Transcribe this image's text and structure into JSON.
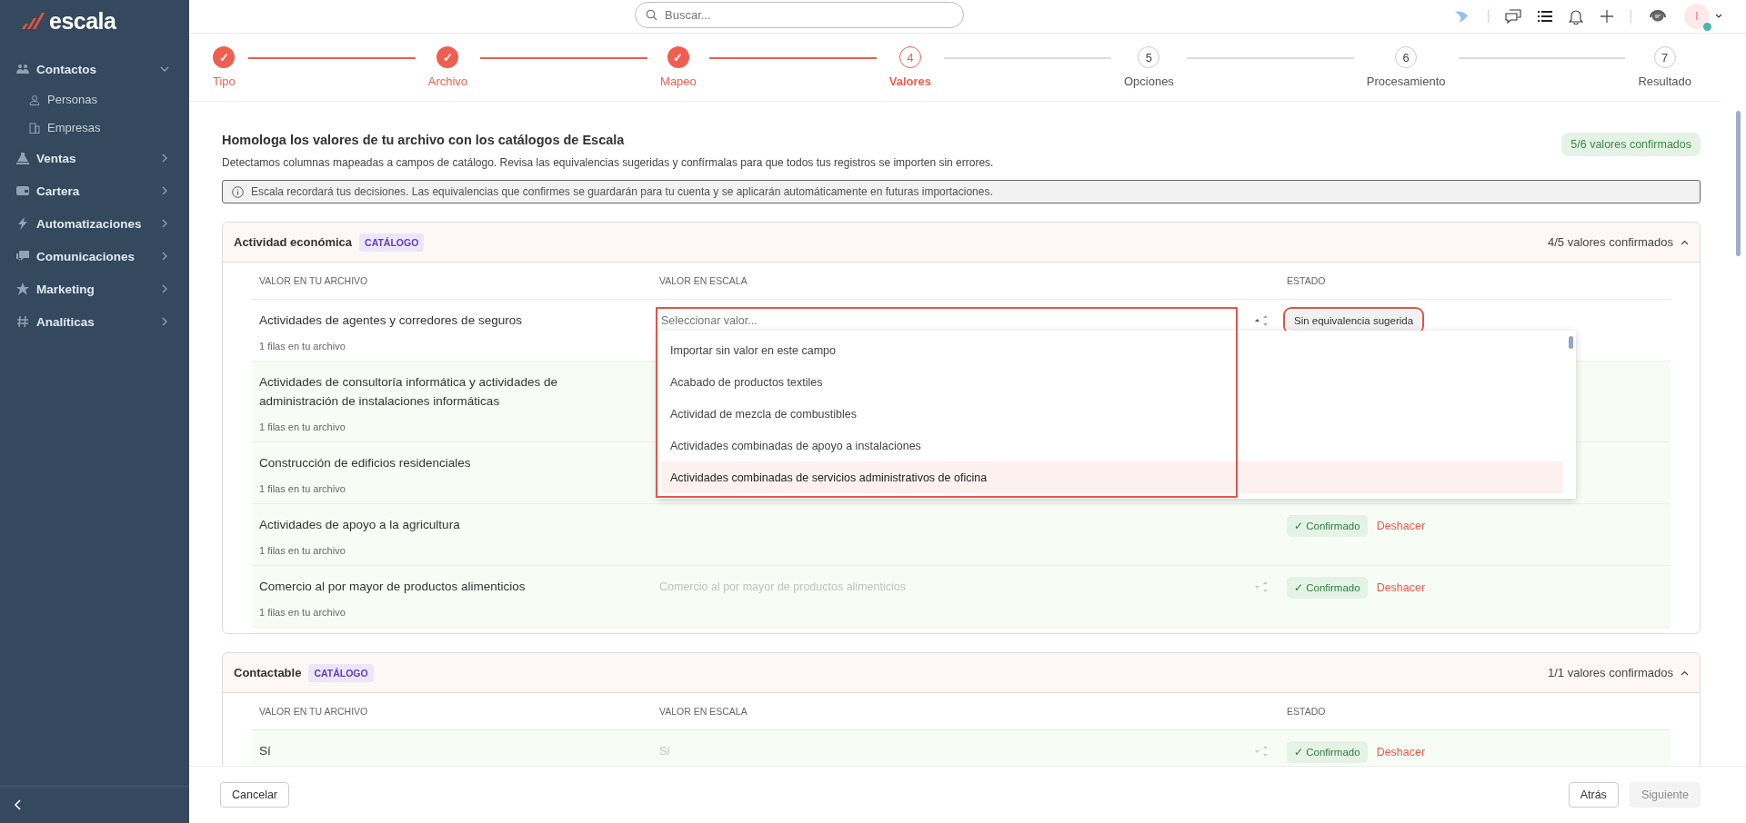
{
  "brand": {
    "name": "escala"
  },
  "sidebar": {
    "items": [
      {
        "label": "Contactos",
        "expanded": true,
        "children": [
          {
            "label": "Personas"
          },
          {
            "label": "Empresas"
          }
        ]
      },
      {
        "label": "Ventas",
        "expanded": false
      },
      {
        "label": "Cartera",
        "expanded": false
      },
      {
        "label": "Automatizaciones",
        "expanded": false
      },
      {
        "label": "Comunicaciones",
        "expanded": false
      },
      {
        "label": "Marketing",
        "expanded": false
      },
      {
        "label": "Analíticas",
        "expanded": false
      }
    ]
  },
  "search": {
    "placeholder": "Buscar..."
  },
  "user": {
    "initial": "I",
    "online": true
  },
  "steps": [
    {
      "marker": "✓",
      "label": "Tipo",
      "completed": true,
      "selected": false
    },
    {
      "marker": "✓",
      "label": "Archivo",
      "completed": true,
      "selected": false
    },
    {
      "marker": "✓",
      "label": "Mapeo",
      "completed": true,
      "selected": false
    },
    {
      "marker": "4",
      "label": "Valores",
      "completed": false,
      "selected": true
    },
    {
      "marker": "5",
      "label": "Opciones",
      "completed": false,
      "selected": false
    },
    {
      "marker": "6",
      "label": "Procesamiento",
      "completed": false,
      "selected": false
    },
    {
      "marker": "7",
      "label": "Resultado",
      "completed": false,
      "selected": false
    }
  ],
  "page": {
    "title": "Homologa los valores de tu archivo con los catálogos de Escala",
    "description": "Detectamos columnas mapeadas a campos de catálogo. Revisa las equivalencias sugeridas y confírmalas para que todos tus registros se importen sin errores.",
    "summary": "5/6 valores confirmados",
    "info": "Escala recordará tus decisiones. Las equivalencias que confirmes se guardarán para tu cuenta y se aplicarán automáticamente en futuras importaciones."
  },
  "sections": [
    {
      "title": "Actividad económica",
      "tag": "CATÁLOGO",
      "count": "4/5 valores confirmados",
      "expanded": true,
      "columns": [
        "VALOR EN TU ARCHIVO",
        "VALOR EN ESCALA",
        "ESTADO"
      ],
      "rows": [
        {
          "kind": "open",
          "value": "Actividades de agentes y corredores de seguros",
          "rows_note": "1 filas en tu archivo",
          "placeholder": "Seleccionar valor...",
          "status": "Sin equivalencia sugerida",
          "confirmed": false,
          "options": [
            {
              "label": "Importar sin valor en este campo",
              "highlighted": false
            },
            {
              "label": "Acabado de productos textiles",
              "highlighted": false
            },
            {
              "label": "Actividad de mezcla de combustibles",
              "highlighted": false
            },
            {
              "label": "Actividades combinadas de apoyo a instalaciones",
              "highlighted": false
            },
            {
              "label": "Actividades combinadas de servicios administrativos de oficina",
              "highlighted": true
            }
          ]
        },
        {
          "kind": "covered",
          "value": "Actividades de consultoría informática y actividades de administración de instalaciones informáticas",
          "rows_note": "1 filas en tu archivo",
          "confirmed": true
        },
        {
          "kind": "covered",
          "value": "Construcción de edificios residenciales",
          "rows_note": "1 filas en tu archivo",
          "confirmed": true
        },
        {
          "kind": "partly",
          "value": "Actividades de apoyo a la agricultura",
          "rows_note": "1 filas en tu archivo",
          "status": "✓ Confirmado",
          "undo": "Deshacer",
          "confirmed": true
        },
        {
          "kind": "full",
          "value": "Comercio al por mayor de productos alimenticios",
          "rows_note": "1 filas en tu archivo",
          "selected_value": "Comercio al por mayor de productos alimenticios",
          "status": "✓ Confirmado",
          "undo": "Deshacer",
          "confirmed": true
        }
      ]
    },
    {
      "title": "Contactable",
      "tag": "CATÁLOGO",
      "count": "1/1 valores confirmados",
      "expanded": true,
      "columns": [
        "VALOR EN TU ARCHIVO",
        "VALOR EN ESCALA",
        "ESTADO"
      ],
      "rows": [
        {
          "kind": "full",
          "value": "Sí",
          "selected_value": "Sí",
          "status": "✓ Confirmado",
          "undo": "Deshacer",
          "confirmed": true
        }
      ]
    }
  ],
  "footer": {
    "cancel": "Cancelar",
    "back": "Atrás",
    "next": "Siguiente",
    "next_disabled": true
  }
}
